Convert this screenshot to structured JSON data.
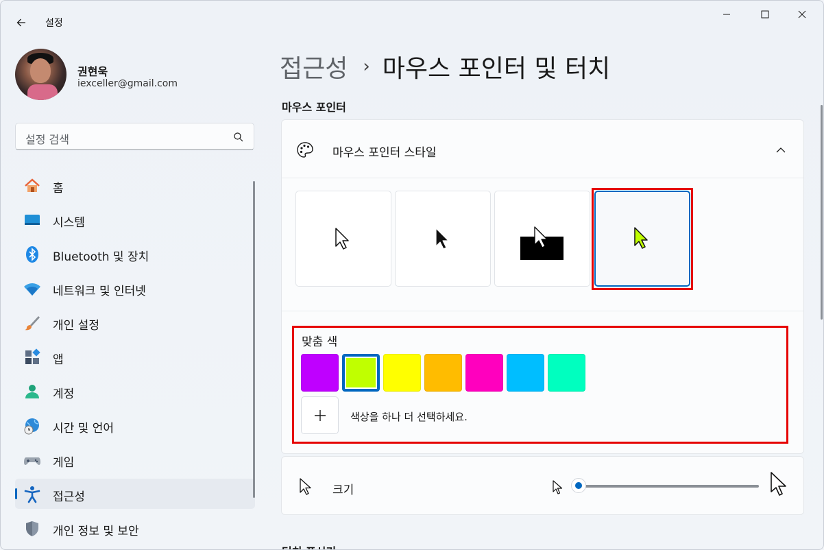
{
  "app": {
    "title": "설정",
    "window_controls": [
      "minimize",
      "maximize",
      "close"
    ]
  },
  "profile": {
    "name": "권현욱",
    "email": "iexceller@gmail.com"
  },
  "search": {
    "placeholder": "설정 검색"
  },
  "sidebar": {
    "items": [
      {
        "label": "홈",
        "icon": "home-icon",
        "active": false
      },
      {
        "label": "시스템",
        "icon": "system-icon",
        "active": false
      },
      {
        "label": "Bluetooth 및 장치",
        "icon": "bluetooth-icon",
        "active": false
      },
      {
        "label": "네트워크 및 인터넷",
        "icon": "wifi-icon",
        "active": false
      },
      {
        "label": "개인 설정",
        "icon": "brush-icon",
        "active": false
      },
      {
        "label": "앱",
        "icon": "apps-icon",
        "active": false
      },
      {
        "label": "계정",
        "icon": "account-icon",
        "active": false
      },
      {
        "label": "시간 및 언어",
        "icon": "globe-clock-icon",
        "active": false
      },
      {
        "label": "게임",
        "icon": "gamepad-icon",
        "active": false
      },
      {
        "label": "접근성",
        "icon": "accessibility-icon",
        "active": true
      },
      {
        "label": "개인 정보 및 보안",
        "icon": "shield-icon",
        "active": false
      }
    ]
  },
  "main": {
    "breadcrumb": {
      "parent": "접근성",
      "separator": "›",
      "current": "마우스 포인터 및 터치"
    },
    "section_title": "마우스 포인터",
    "pointer_style": {
      "label": "마우스 포인터 스타일",
      "expanded": true,
      "styles": [
        "white",
        "black",
        "inverted",
        "custom"
      ],
      "selected_style": "custom"
    },
    "custom_color": {
      "label": "맞춤 색",
      "colors": [
        "#BF00FF",
        "#C0FF00",
        "#FFFF00",
        "#FFBC00",
        "#FF00BE",
        "#00BEFF",
        "#00FFBF"
      ],
      "selected_index": 1,
      "add_label": "색상을 하나 더 선택하세요."
    },
    "size": {
      "label": "크기",
      "value_fraction": 0.0
    },
    "next_section_title": "터치 표시기"
  },
  "highlight_color": "#E60000",
  "accent_color": "#0067C0"
}
